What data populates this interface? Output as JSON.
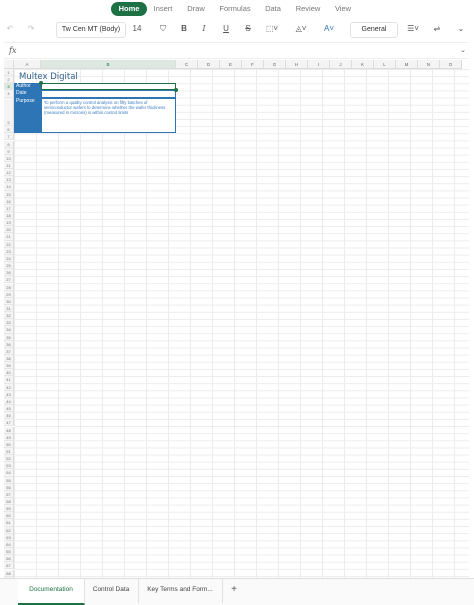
{
  "ribbon": {
    "tabs": [
      {
        "label": "Home",
        "active": true
      },
      {
        "label": "Insert",
        "active": false
      },
      {
        "label": "Draw",
        "active": false
      },
      {
        "label": "Formulas",
        "active": false
      },
      {
        "label": "Data",
        "active": false
      },
      {
        "label": "Review",
        "active": false
      },
      {
        "label": "View",
        "active": false
      }
    ]
  },
  "toolbar": {
    "font_name": "Tw Cen MT (Body)",
    "font_size": "14",
    "number_format": "General",
    "bold": "B",
    "italic": "I",
    "underline": "U",
    "strikethrough": "S",
    "undo_icon": "undo-icon",
    "redo_icon": "redo-icon"
  },
  "formula_bar": {
    "fx_label": "fx",
    "value": ""
  },
  "sheet": {
    "columns": [
      "A",
      "B",
      "C",
      "D",
      "E",
      "F",
      "G",
      "H",
      "I",
      "J",
      "K",
      "L",
      "M",
      "N",
      "O"
    ],
    "selected_column": "B",
    "selected_row": "3",
    "row_count": 71,
    "title": "Multex Digital",
    "fields": [
      {
        "label": "Author",
        "value": ""
      },
      {
        "label": "Date",
        "value": ""
      },
      {
        "label": "Purpose",
        "value": "To perform a quality control analysis on fifty batches of semiconductor wafers to determine whether the wafer thickness (measured in microns) is within control limits"
      }
    ]
  },
  "sheet_tabs": {
    "tabs": [
      {
        "label": "Documentation",
        "active": true
      },
      {
        "label": "Control Data",
        "active": false
      },
      {
        "label": "Key Terms and Form...",
        "active": false
      }
    ],
    "add_label": "+"
  },
  "colors": {
    "accent": "#1e7145",
    "header_fill": "#2e75b6",
    "title_color": "#2f5f8a"
  }
}
